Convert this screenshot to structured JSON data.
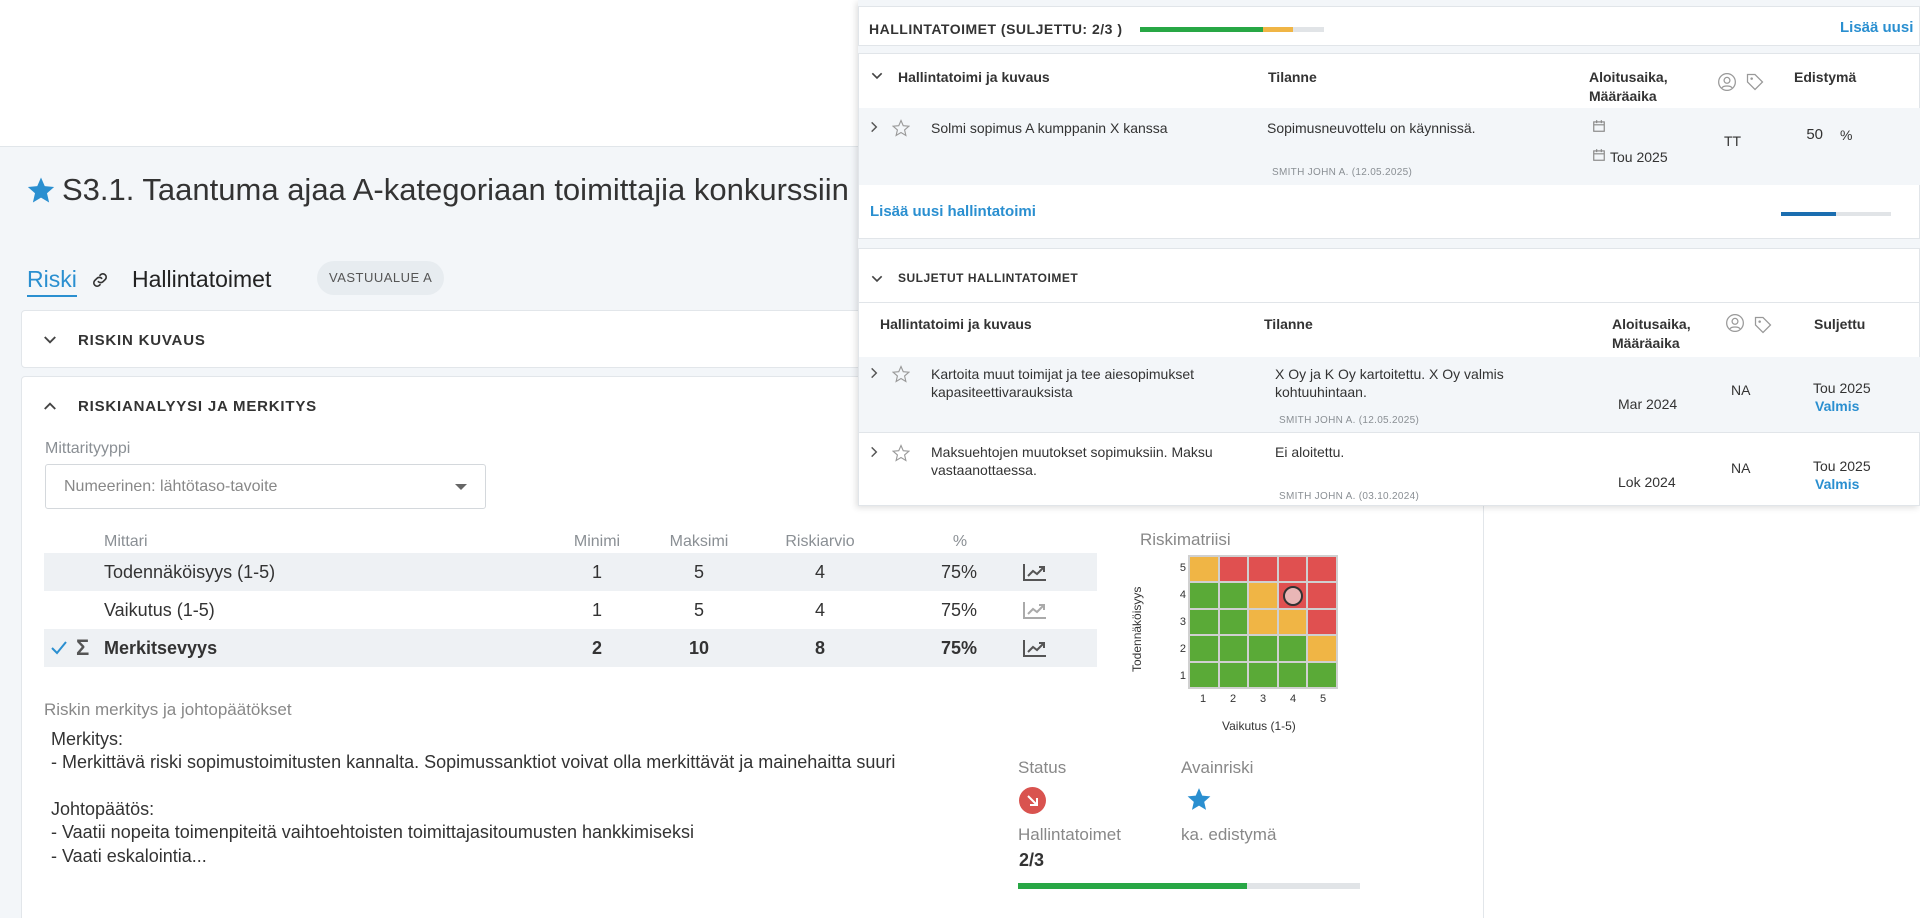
{
  "risk": {
    "title": "S3.1. Taantuma ajaa A-kategoriaan toimittajia konkurssiin",
    "tabs": {
      "riski": "Riski",
      "hallintatoimet": "Hallintatoimet"
    },
    "area_chip": "VASTUUALUE A",
    "panels": {
      "kuvaus": "RISKIN KUVAUS",
      "analyysi": "RISKIANALYYSI JA MERKITYS"
    },
    "mittarityyppi_label": "Mittarityyppi",
    "mittarityyppi_value": "Numeerinen: lähtötaso-tavoite",
    "metrics": {
      "headers": {
        "mittari": "Mittari",
        "minimi": "Minimi",
        "maksimi": "Maksimi",
        "riskiarvio": "Riskiarvio",
        "pct": "%"
      },
      "rows": [
        {
          "name": "Todennäköisyys (1-5)",
          "min": "1",
          "max": "5",
          "arvio": "4",
          "pct": "75%"
        },
        {
          "name": "Vaikutus (1-5)",
          "min": "1",
          "max": "5",
          "arvio": "4",
          "pct": "75%"
        },
        {
          "name": "Merkitsevyys",
          "min": "2",
          "max": "10",
          "arvio": "8",
          "pct": "75%"
        }
      ],
      "sigma": "Σ"
    },
    "matrix": {
      "title": "Riskimatriisi",
      "y_label": "Todennäköisyys",
      "x_label": "Vaikutus (1-5)",
      "x_ticks": [
        "1",
        "2",
        "3",
        "4",
        "5"
      ],
      "y_ticks": [
        "5",
        "4",
        "3",
        "2",
        "1"
      ],
      "cells": [
        [
          "y",
          "r",
          "r",
          "r",
          "r"
        ],
        [
          "g",
          "g",
          "y",
          "r",
          "r"
        ],
        [
          "g",
          "g",
          "y",
          "y",
          "r"
        ],
        [
          "g",
          "g",
          "g",
          "g",
          "y"
        ],
        [
          "g",
          "g",
          "g",
          "g",
          "g"
        ]
      ],
      "marker": {
        "vaikutus": 4,
        "todennakoisyys": 4
      },
      "colors": {
        "g": "#5aaa37",
        "y": "#f0b545",
        "r": "#e05050"
      }
    },
    "merkitys_label": "Riskin merkitys ja johtopäätökset",
    "conclusions": [
      "Merkitys:",
      "- Merkittävä riski sopimustoimitusten kannalta. Sopimussanktiot voivat olla merkittävät ja mainehaitta suuri",
      "",
      "Johtopäätös:",
      "- Vaatii nopeita toimenpiteitä vaihtoehtoisten toimittajasitoumusten hankkimiseksi",
      "- Vaati eskalointia..."
    ],
    "status_label": "Status",
    "avainriski_label": "Avainriski",
    "hallintatoimet_label": "Hallintatoimet",
    "hallintatoimet_value": "2/3",
    "hallintatoimet_progress": 0.67,
    "ka_edistyma_label": "ka. edistymä"
  },
  "overlay": {
    "header_title": "HALLINTATOIMET (SULJETTU: 2/3 )",
    "header_progress": {
      "green": 0.67,
      "yellow": 0.16
    },
    "add_link": "Lisää uusi",
    "open_headers": {
      "toimi": "Hallintatoimi ja kuvaus",
      "tilanne": "Tilanne",
      "aika": "Aloitusaika,\nMääräaika",
      "edistyma": "Edistymä"
    },
    "open_rows": [
      {
        "title": "Solmi sopimus A kumppanin X kanssa",
        "status": "Sopimusneuvottelu on käynnissä.",
        "meta": "SMITH JOHN A. (12.05.2025)",
        "deadline": "Tou 2025",
        "owner": "TT",
        "progress": "50",
        "progress_unit": "%",
        "progress_value": 0.5
      }
    ],
    "add_action": "Lisää uusi hallintatoimi",
    "closed_title": "SULJETUT HALLINTATOIMET",
    "closed_headers": {
      "toimi": "Hallintatoimi ja kuvaus",
      "tilanne": "Tilanne",
      "aika": "Aloitusaika,\nMääräaika",
      "suljettu": "Suljettu"
    },
    "closed_rows": [
      {
        "title": "Kartoita muut toimijat ja tee aiesopimukset kapasiteettivarauksista",
        "status": "X Oy ja K Oy kartoitettu. X Oy valmis kohtuuhintaan.",
        "meta": "SMITH JOHN A. (12.05.2025)",
        "start": "Mar 2024",
        "owner": "NA",
        "closed": "Tou 2025",
        "state": "Valmis"
      },
      {
        "title": "Maksuehtojen muutokset sopimuksiin. Maksu vastaanottaessa.",
        "status": "Ei aloitettu.",
        "meta": "SMITH JOHN A. (03.10.2024)",
        "start": "Lok 2024",
        "owner": "NA",
        "closed": "Tou 2025",
        "state": "Valmis"
      }
    ]
  }
}
